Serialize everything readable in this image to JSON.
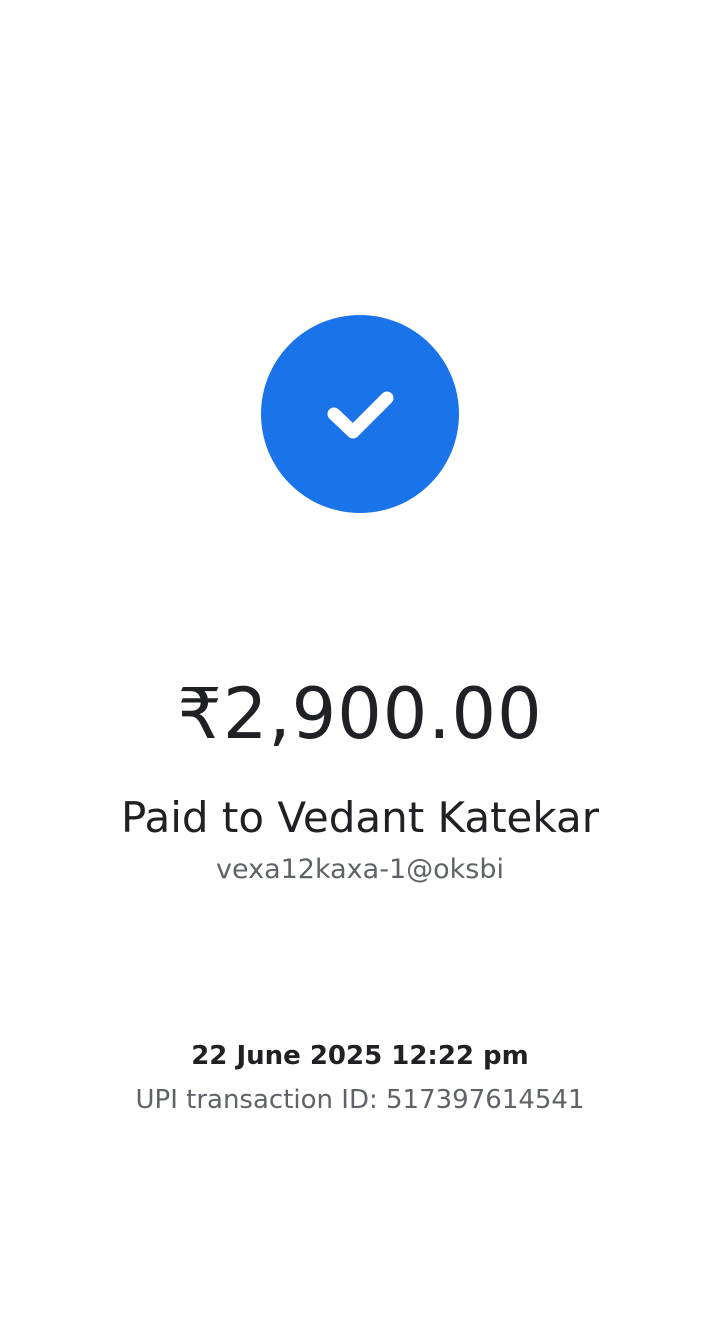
{
  "status": {
    "icon": "check-icon",
    "color": "#1a73e8"
  },
  "payment": {
    "amount": "₹2,900.00",
    "paid_to": "Paid to Vedant Katekar",
    "upi_id": "vexa12kaxa-1@oksbi"
  },
  "details": {
    "datetime": "22 June 2025 12:22 pm",
    "transaction_id": "UPI transaction ID: 517397614541"
  },
  "colors": {
    "primary_text": "#202124",
    "secondary_text": "#5f6368",
    "background": "#ffffff"
  }
}
